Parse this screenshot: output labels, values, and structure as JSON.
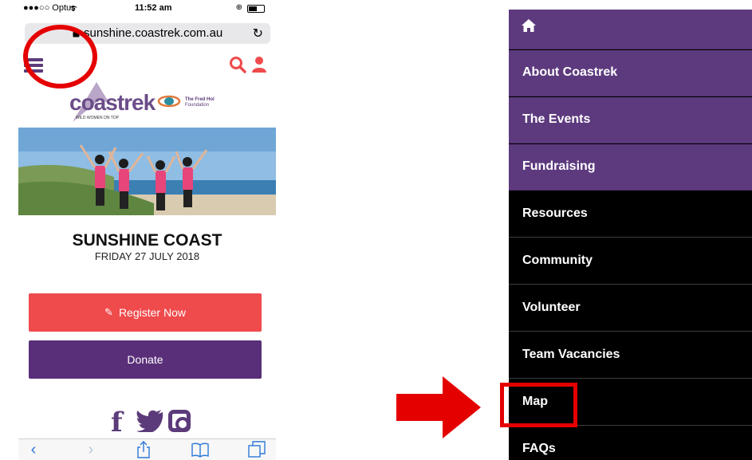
{
  "phone": {
    "status_bar": {
      "carrier": "●●●○○ Optus",
      "time": "11:52 am"
    },
    "url": "sunshine.coastrek.com.au",
    "logo": {
      "word": "coastrek",
      "tagline": "WILD WOMEN ON TOP",
      "partner_line1": "The Fred Hol",
      "partner_line2": "Foundation"
    },
    "event_title": "SUNSHINE COAST",
    "event_date": "FRIDAY 27 JULY 2018",
    "register_label": "Register Now",
    "donate_label": "Donate",
    "social_facebook": "f",
    "icons": [
      "hamburger-menu-icon",
      "search-icon",
      "user-icon",
      "lock-icon",
      "reload-icon",
      "facebook-icon",
      "twitter-icon",
      "instagram-icon",
      "edit-icon",
      "back-icon",
      "forward-icon",
      "share-icon",
      "bookmarks-icon",
      "tabs-icon"
    ],
    "colors": {
      "purple": "#5a2f79",
      "coral": "#ef4a4c",
      "safari_blue": "#2b78d6"
    }
  },
  "annotations": {
    "circle_color": "#e50000",
    "arrow_color": "#e50000"
  },
  "nav_menu": {
    "home_icon": "home-icon",
    "items": [
      {
        "label": "About Coastrek"
      },
      {
        "label": "The Events"
      },
      {
        "label": "Fundraising"
      },
      {
        "label": "Resources"
      },
      {
        "label": "Community"
      },
      {
        "label": "Volunteer"
      },
      {
        "label": "Team Vacancies"
      },
      {
        "label": "Map"
      },
      {
        "label": "FAQs"
      }
    ],
    "colors": {
      "purple_bg": "#5d3a7e",
      "dark_bg": "#000000"
    }
  }
}
